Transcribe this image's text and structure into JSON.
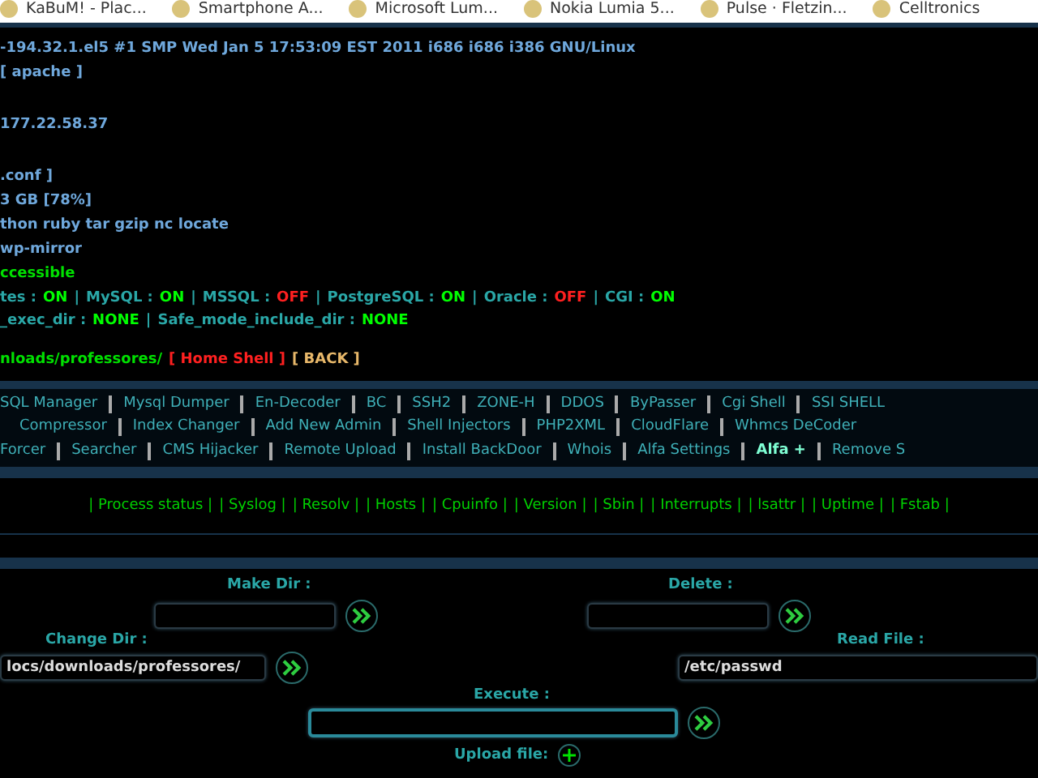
{
  "bookmarks": [
    {
      "label": "KaBuM! - Plac..."
    },
    {
      "label": "Smartphone A..."
    },
    {
      "label": "Microsoft Lum..."
    },
    {
      "label": "Nokia Lumia 5..."
    },
    {
      "label": "Pulse · Fletzin..."
    },
    {
      "label": "Celltronics"
    }
  ],
  "system_info": [
    "-194.32.1.el5 #1 SMP Wed Jan 5 17:53:09 EST 2011 i686 i686 i386 GNU/Linux",
    "[ apache ]",
    "177.22.58.37",
    ".conf ]",
    "3 GB [78%]",
    "thon ruby tar gzip nc locate",
    "wp-mirror"
  ],
  "access": "ccessible",
  "separator": "|",
  "services": [
    {
      "label": "tes :",
      "value": "ON",
      "on": true
    },
    {
      "label": "MySQL :",
      "value": "ON",
      "on": true
    },
    {
      "label": "MSSQL :",
      "value": "OFF",
      "on": false
    },
    {
      "label": "PostgreSQL :",
      "value": "ON",
      "on": true
    },
    {
      "label": "Oracle :",
      "value": "OFF",
      "on": false
    },
    {
      "label": "CGI :",
      "value": "ON",
      "on": true
    }
  ],
  "safe_mode": [
    {
      "label": "_exec_dir :",
      "value": "NONE"
    },
    {
      "label": "Safe_mode_include_dir :",
      "value": "NONE"
    }
  ],
  "path": {
    "text": "nloads/professores/",
    "home": "[ Home Shell ]",
    "back": "[ BACK ]"
  },
  "menu_rows": [
    [
      {
        "label": "SQL Manager",
        "highlighted": false
      },
      {
        "label": "Mysql Dumper",
        "highlighted": false
      },
      {
        "label": "En-Decoder",
        "highlighted": false
      },
      {
        "label": "BC",
        "highlighted": false
      },
      {
        "label": "SSH2",
        "highlighted": false
      },
      {
        "label": "ZONE-H",
        "highlighted": false
      },
      {
        "label": "DDOS",
        "highlighted": false
      },
      {
        "label": "ByPasser",
        "highlighted": false
      },
      {
        "label": "Cgi Shell",
        "highlighted": false
      },
      {
        "label": "SSI SHELL",
        "highlighted": false
      }
    ],
    [
      {
        "label": "Compressor",
        "highlighted": false
      },
      {
        "label": "Index Changer",
        "highlighted": false
      },
      {
        "label": "Add New Admin",
        "highlighted": false
      },
      {
        "label": "Shell Injectors",
        "highlighted": false
      },
      {
        "label": "PHP2XML",
        "highlighted": false
      },
      {
        "label": "CloudFlare",
        "highlighted": false
      },
      {
        "label": "Whmcs DeCoder",
        "highlighted": false
      }
    ],
    [
      {
        "label": "Forcer",
        "highlighted": false
      },
      {
        "label": "Searcher",
        "highlighted": false
      },
      {
        "label": "CMS Hijacker",
        "highlighted": false
      },
      {
        "label": "Remote Upload",
        "highlighted": false
      },
      {
        "label": "Install BackDoor",
        "highlighted": false
      },
      {
        "label": "Whois",
        "highlighted": false
      },
      {
        "label": "Alfa Settings",
        "highlighted": false
      },
      {
        "label": "Alfa +",
        "highlighted": true
      },
      {
        "label": "Remove S",
        "highlighted": false
      }
    ]
  ],
  "tools": [
    "| Process status |",
    "| Syslog |",
    "| Resolv |",
    "| Hosts |",
    "| Cpuinfo |",
    "| Version |",
    "| Sbin |",
    "| Interrupts |",
    "| lsattr |",
    "| Uptime |",
    "| Fstab |"
  ],
  "forms": {
    "make_dir": {
      "label": "Make Dir :"
    },
    "delete": {
      "label": "Delete :"
    },
    "change_dir": {
      "label": "Change Dir :",
      "value": "locs/downloads/professores/"
    },
    "read_file": {
      "label": "Read File :",
      "value": "/etc/passwd"
    },
    "execute": {
      "label": "Execute :"
    },
    "upload": {
      "label": "Upload file:"
    }
  }
}
